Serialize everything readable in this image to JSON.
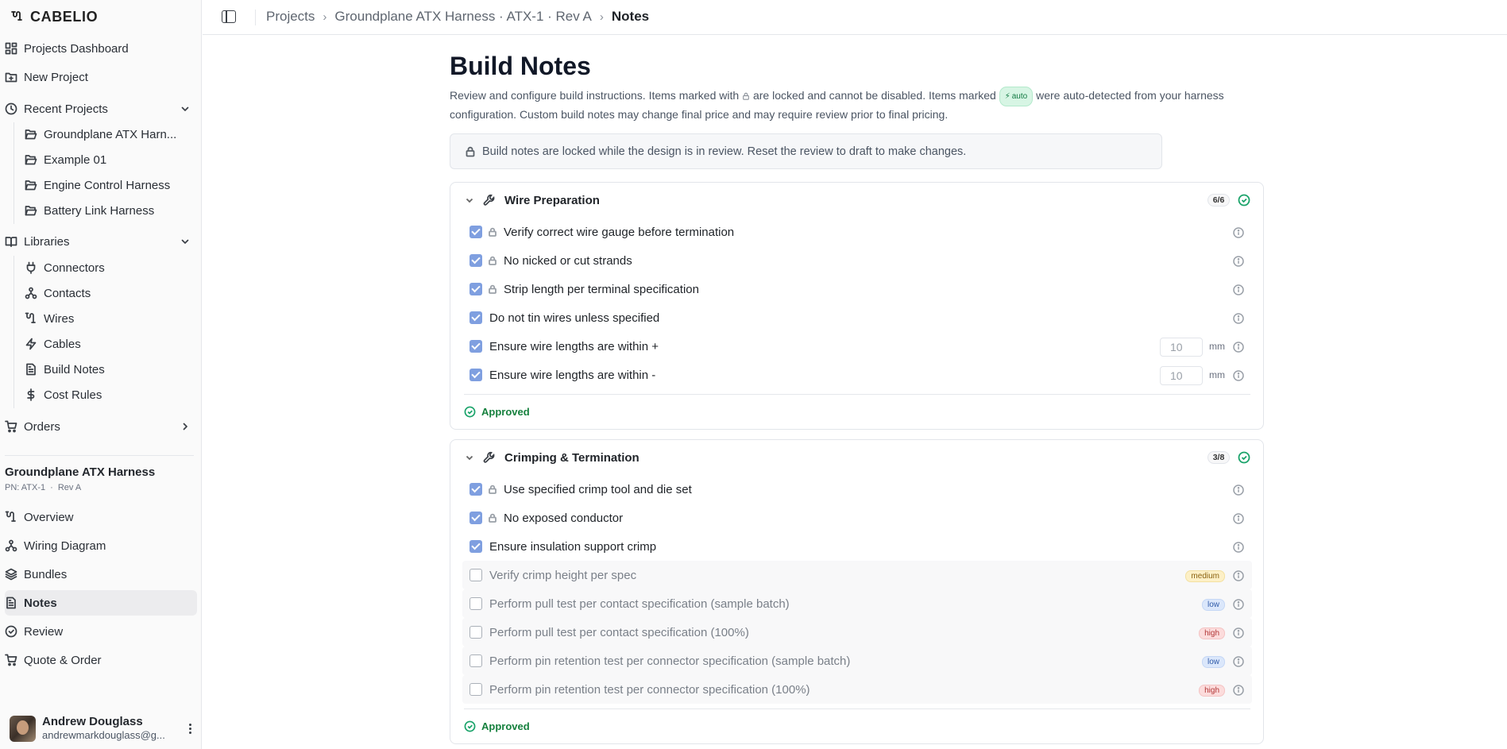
{
  "brand": {
    "name": "CABELIO"
  },
  "sidebar": {
    "top": [
      {
        "label": "Projects Dashboard"
      },
      {
        "label": "New Project"
      }
    ],
    "recent": {
      "label": "Recent Projects",
      "items": [
        "Groundplane ATX Harn...",
        "Example 01",
        "Engine Control Harness",
        "Battery Link Harness"
      ]
    },
    "libraries": {
      "label": "Libraries",
      "items": [
        "Connectors",
        "Contacts",
        "Wires",
        "Cables",
        "Build Notes",
        "Cost Rules"
      ]
    },
    "orders": {
      "label": "Orders"
    },
    "project": {
      "title": "Groundplane ATX Harness",
      "pn": "PN: ATX-1",
      "rev": "Rev A",
      "items": [
        "Overview",
        "Wiring Diagram",
        "Bundles",
        "Notes",
        "Review",
        "Quote & Order"
      ],
      "active": "Notes"
    },
    "user": {
      "name": "Andrew Douglass",
      "email": "andrewmarkdouglass@g..."
    }
  },
  "breadcrumb": [
    "Projects",
    "Groundplane ATX Harness · ATX-1 · Rev A",
    "Notes"
  ],
  "page": {
    "title": "Build Notes",
    "intro_a": "Review and configure build instructions. Items marked with",
    "intro_b": "are locked and cannot be disabled. Items marked",
    "auto_label": "auto",
    "intro_c": "were auto-detected from your harness configuration. Custom build notes may change final price and may require review prior to final pricing.",
    "lock_notice": "Build notes are locked while the design is in review. Reset the review to draft to make changes."
  },
  "sections": [
    {
      "title": "Wire Preparation",
      "count": "6/6",
      "status": "Approved",
      "rows": [
        {
          "label": "Verify correct wire gauge before termination",
          "checked": true,
          "locked": true
        },
        {
          "label": "No nicked or cut strands",
          "checked": true,
          "locked": true
        },
        {
          "label": "Strip length per terminal specification",
          "checked": true,
          "locked": true
        },
        {
          "label": "Do not tin wires unless specified",
          "checked": true,
          "locked": false
        },
        {
          "label": "Ensure wire lengths are within +",
          "checked": true,
          "locked": false,
          "value": "10",
          "unit": "mm"
        },
        {
          "label": "Ensure wire lengths are within -",
          "checked": true,
          "locked": false,
          "value": "10",
          "unit": "mm"
        }
      ]
    },
    {
      "title": "Crimping & Termination",
      "count": "3/8",
      "status": "Approved",
      "rows": [
        {
          "label": "Use specified crimp tool and die set",
          "checked": true,
          "locked": true
        },
        {
          "label": "No exposed conductor",
          "checked": true,
          "locked": true
        },
        {
          "label": "Ensure insulation support crimp",
          "checked": true,
          "locked": false
        },
        {
          "label": "Verify crimp height per spec",
          "checked": false,
          "locked": false,
          "priority": "medium"
        },
        {
          "label": "Perform pull test per contact specification (sample batch)",
          "checked": false,
          "locked": false,
          "priority": "low"
        },
        {
          "label": "Perform pull test per contact specification (100%)",
          "checked": false,
          "locked": false,
          "priority": "high"
        },
        {
          "label": "Perform pin retention test per connector specification (sample batch)",
          "checked": false,
          "locked": false,
          "priority": "low"
        },
        {
          "label": "Perform pin retention test per connector specification (100%)",
          "checked": false,
          "locked": false,
          "priority": "high"
        }
      ]
    }
  ]
}
